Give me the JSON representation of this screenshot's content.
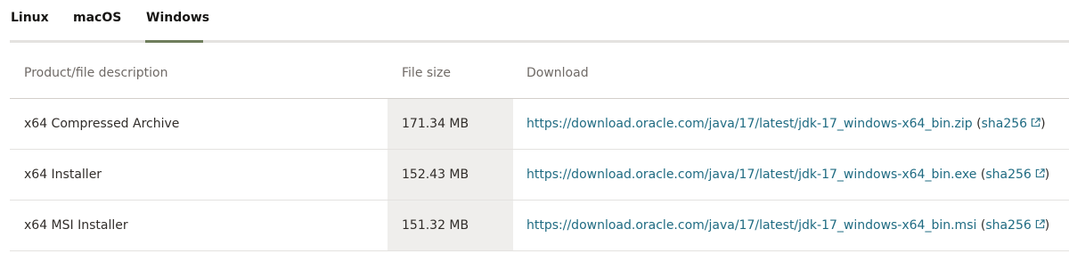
{
  "tabs": {
    "items": [
      {
        "label": "Linux",
        "active": false
      },
      {
        "label": "macOS",
        "active": false
      },
      {
        "label": "Windows",
        "active": true
      }
    ],
    "active_color": "#6f7e5c"
  },
  "table": {
    "headers": {
      "description": "Product/file description",
      "size": "File size",
      "download": "Download"
    },
    "rows": [
      {
        "description": "x64 Compressed Archive",
        "size": "171.34 MB",
        "url": "https://download.oracle.com/java/17/latest/jdk-17_windows-x64_bin.zip",
        "checksum_label": "sha256",
        "checksum_icon": "external-link-icon"
      },
      {
        "description": "x64 Installer",
        "size": "152.43 MB",
        "url": "https://download.oracle.com/java/17/latest/jdk-17_windows-x64_bin.exe",
        "checksum_label": "sha256",
        "checksum_icon": "external-link-icon"
      },
      {
        "description": "x64 MSI Installer",
        "size": "151.32 MB",
        "url": "https://download.oracle.com/java/17/latest/jdk-17_windows-x64_bin.msi",
        "checksum_label": "sha256",
        "checksum_icon": "external-link-icon"
      }
    ],
    "link_color": "#1f6b82"
  }
}
